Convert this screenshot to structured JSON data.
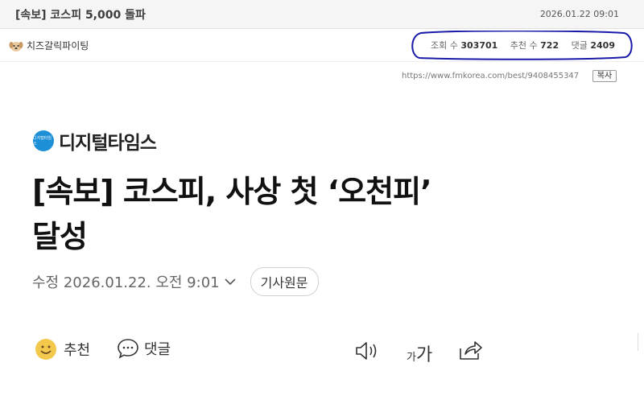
{
  "post": {
    "title": "[속보] 코스피 5,000 돌파",
    "date": "2026.01.22 09:01",
    "author": "치즈갈릭파이팅",
    "stats": {
      "views_label": "조회 수",
      "views": "303701",
      "recommend_label": "추천 수",
      "recommend": "722",
      "comments_label": "댓글",
      "comments": "2409"
    },
    "url": "https://www.fmkorea.com/best/9408455347",
    "copy_label": "복사"
  },
  "article": {
    "publisher": "디지털타임스",
    "publisher_logo_text": "디지털타임스",
    "headline_line1": "[속보] 코스피, 사상 첫 ‘오천피’",
    "headline_line2": "달성",
    "modified": "수정 2026.01.22. 오전 9:01",
    "original_label": "기사원문",
    "recommend_label": "추천",
    "comment_label": "댓글",
    "font_small": "가",
    "font_big": "가"
  },
  "colors": {
    "highlight": "#1a1aa8",
    "publisher_blue": "#1d8fd7",
    "smiley": "#f2c94c"
  },
  "icons": [
    "avatar-dog-icon",
    "chevron-down-icon",
    "smile-icon",
    "speech-bubble-icon",
    "speaker-icon",
    "share-icon"
  ]
}
